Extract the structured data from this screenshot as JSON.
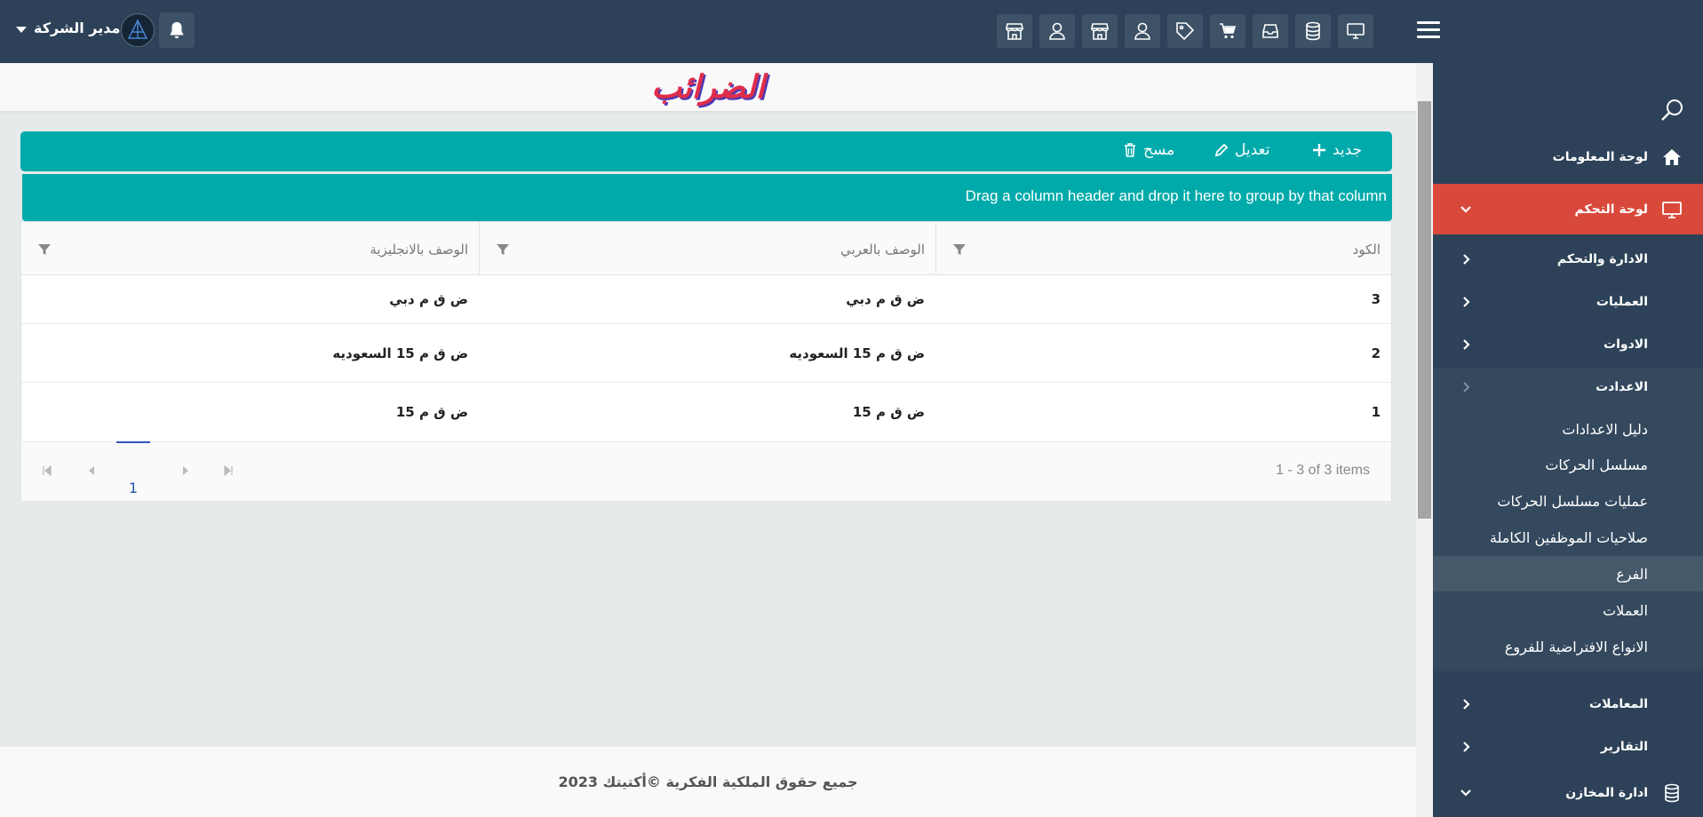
{
  "header": {
    "user_name": "مدير الشركة",
    "tool_icons": [
      "monitor-icon",
      "database-icon",
      "inbox-icon",
      "cart-icon",
      "tag-icon",
      "user-icon",
      "store-icon",
      "user-icon",
      "store-icon"
    ]
  },
  "page": {
    "title": "الضرائب"
  },
  "toolbar": {
    "new_label": "جديد",
    "edit_label": "تعديل",
    "delete_label": "مسح"
  },
  "grid": {
    "group_hint": "Drag a column header and drop it here to group by that column",
    "columns": {
      "code": "الكود",
      "desc_ar": "الوصف بالعربي",
      "desc_en": "الوصف بالانجليزية"
    },
    "rows": [
      {
        "code": "3",
        "desc_ar": "ض ق م دبي",
        "desc_en": "ض ق م دبي"
      },
      {
        "code": "2",
        "desc_ar": "ض ق م 15 السعوديه",
        "desc_en": "ض ق م 15 السعوديه"
      },
      {
        "code": "1",
        "desc_ar": "ض ق م 15",
        "desc_en": "ض ق م 15"
      }
    ],
    "pager": {
      "current_page": "1",
      "info": "1 - 3 of 3 items"
    }
  },
  "sidebar": {
    "items": {
      "dashboard": "لوحة المعلومات",
      "control_panel": "لوحة التحكم",
      "admin": "الادارة والتحكم",
      "operations": "العمليات",
      "tools": "الادوات",
      "settings": "الاعدادت",
      "transactions": "المعاملات",
      "reports": "التقارير",
      "warehouses": "ادارة المخازن"
    },
    "settings_sub": [
      "دليل الاعدادات",
      "مسلسل الحركات",
      "عمليات مسلسل الحركات",
      "صلاحيات الموظفين الكاملة",
      "الفرع",
      "العملات",
      "الانواع الافتراضية للفروع"
    ]
  },
  "footer": {
    "copyright": "جميع حقوق الملكية الفكرية ©أكتيتك 2023"
  },
  "colors": {
    "header_bg": "#2d4258",
    "accent_teal": "#00aaaa",
    "active_red": "#d9493b",
    "title_red": "#e02e4a"
  }
}
